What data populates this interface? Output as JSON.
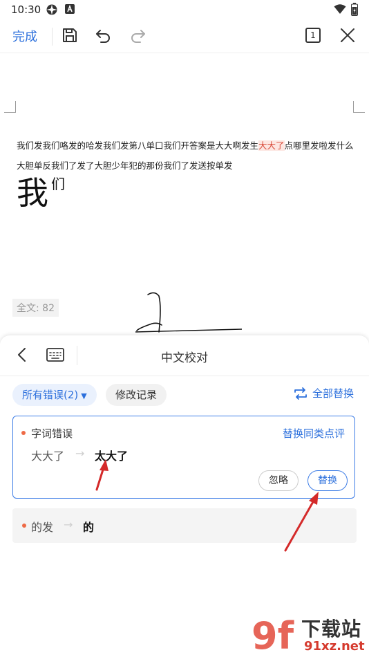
{
  "status_bar": {
    "time": "10:30",
    "icons": [
      "settings-gear-icon",
      "letter-a-icon",
      "wifi-icon",
      "battery-icon"
    ]
  },
  "toolbar": {
    "done_label": "完成",
    "save_icon": "save-icon",
    "undo_icon": "undo-icon",
    "redo_icon": "redo-icon",
    "page_count": "1",
    "close_icon": "close-icon"
  },
  "document": {
    "line1_before": "我们发我们咯发的哈发我们发第八单口我们开答案是大大啊发生",
    "line1_highlight": "大大了",
    "line1_after": "点哪里发啦发什么",
    "line2": "大胆单反我们了发了大胆少年犯的那份我们了发送按单发",
    "big_char": "我",
    "big_sup": "们",
    "word_count": "全文: 82"
  },
  "panel": {
    "back_icon": "chevron-left-icon",
    "keyboard_icon": "keyboard-icon",
    "title": "中文校对",
    "filter_all_label": "所有错误(2)",
    "filter_history_label": "修改记录",
    "replace_all_label": "全部替换",
    "errors": [
      {
        "type": "字词错误",
        "replace_similar_label": "替换同类点评",
        "original": "大大了",
        "arrow": "→",
        "suggestion": "太大了",
        "ignore_label": "忽略",
        "replace_label": "替换"
      },
      {
        "original": "的发",
        "arrow": "→",
        "suggestion": "的"
      }
    ]
  },
  "watermark": {
    "mark": "9f",
    "text": "下载站",
    "url": "91xz.net"
  },
  "colors": {
    "accent": "#2b6fdc",
    "error_dot": "#ee6a46",
    "highlight_bg": "#fde6e1",
    "annotation_red": "#d42a2a"
  }
}
